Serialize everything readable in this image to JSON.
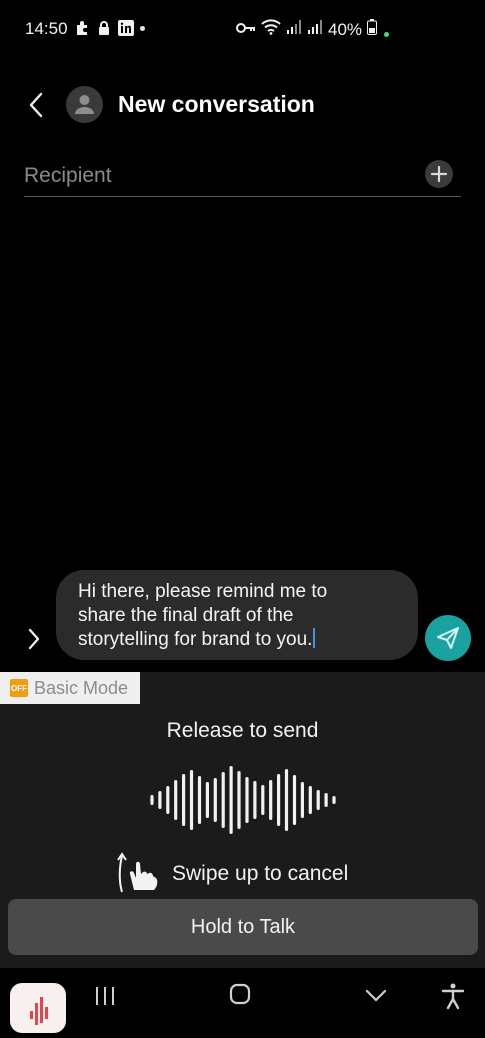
{
  "status_bar": {
    "time": "14:50",
    "battery": "40%",
    "left_icons": [
      "puzzle-icon",
      "lock-icon",
      "linkedin-icon",
      "dot"
    ],
    "right_icons": [
      "key-icon",
      "wifi-icon",
      "signal-icon",
      "signal-icon",
      "battery-icon"
    ]
  },
  "header": {
    "title": "New conversation"
  },
  "recipient": {
    "placeholder": "Recipient"
  },
  "composer": {
    "message": "Hi there, please remind me to\nshare the final draft of the\nstorytelling for brand to you."
  },
  "voice_panel": {
    "basic_mode_label": "Basic Mode",
    "release_text": "Release to send",
    "swipe_text": "Swipe up to cancel",
    "hold_button": "Hold to Talk"
  },
  "colors": {
    "send_button": "#1aa2a1",
    "panel_bg": "#1b1b1b",
    "bubble_bg": "#2b2b2b"
  }
}
